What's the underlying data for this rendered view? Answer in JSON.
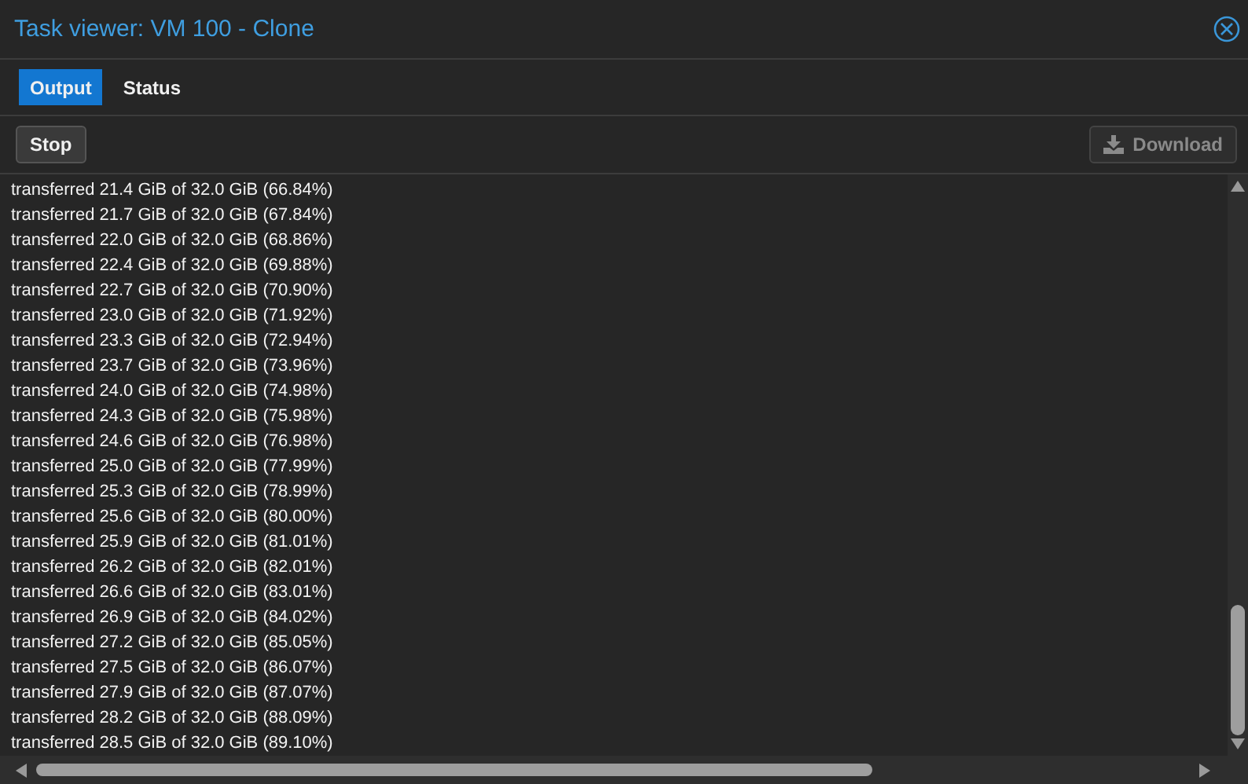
{
  "window": {
    "title": "Task viewer: VM 100 - Clone"
  },
  "tabs": [
    {
      "label": "Output",
      "selected": true
    },
    {
      "label": "Status",
      "selected": false
    }
  ],
  "toolbar": {
    "buttons": [
      {
        "label": "Stop",
        "disabled": false,
        "kind": "plain"
      },
      {
        "label": "Download",
        "disabled": true,
        "kind": "download"
      }
    ]
  },
  "log": {
    "lines": [
      "transferred 21.4 GiB of 32.0 GiB (66.84%)",
      "transferred 21.7 GiB of 32.0 GiB (67.84%)",
      "transferred 22.0 GiB of 32.0 GiB (68.86%)",
      "transferred 22.4 GiB of 32.0 GiB (69.88%)",
      "transferred 22.7 GiB of 32.0 GiB (70.90%)",
      "transferred 23.0 GiB of 32.0 GiB (71.92%)",
      "transferred 23.3 GiB of 32.0 GiB (72.94%)",
      "transferred 23.7 GiB of 32.0 GiB (73.96%)",
      "transferred 24.0 GiB of 32.0 GiB (74.98%)",
      "transferred 24.3 GiB of 32.0 GiB (75.98%)",
      "transferred 24.6 GiB of 32.0 GiB (76.98%)",
      "transferred 25.0 GiB of 32.0 GiB (77.99%)",
      "transferred 25.3 GiB of 32.0 GiB (78.99%)",
      "transferred 25.6 GiB of 32.0 GiB (80.00%)",
      "transferred 25.9 GiB of 32.0 GiB (81.01%)",
      "transferred 26.2 GiB of 32.0 GiB (82.01%)",
      "transferred 26.6 GiB of 32.0 GiB (83.01%)",
      "transferred 26.9 GiB of 32.0 GiB (84.02%)",
      "transferred 27.2 GiB of 32.0 GiB (85.05%)",
      "transferred 27.5 GiB of 32.0 GiB (86.07%)",
      "transferred 27.9 GiB of 32.0 GiB (87.07%)",
      "transferred 28.2 GiB of 32.0 GiB (88.09%)",
      "transferred 28.5 GiB of 32.0 GiB (89.10%)"
    ]
  }
}
